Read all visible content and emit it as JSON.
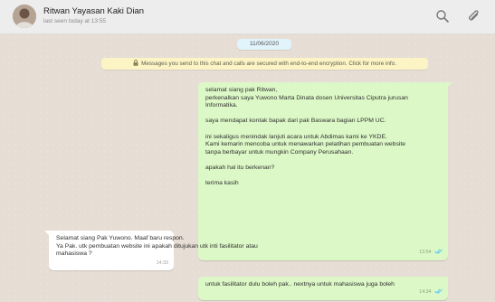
{
  "header": {
    "contact_name": "Ritwan Yayasan Kaki Dian",
    "last_seen": "last seen today at 13:55",
    "icons": [
      "search-icon",
      "paperclip-icon"
    ]
  },
  "chat": {
    "date": "11/06/2020",
    "encryption_notice": "Messages you send to this chat and calls are secured with end-to-end encryption. Click for more info.",
    "messages": [
      {
        "direction": "outgoing",
        "lines": [
          "selamat siang pak Ritwan,",
          "perkenalkan saya Yuwono Marta Dinata dosen Universitas Ciputra jurusan",
          "Informatika.",
          "",
          "saya mendapat kontak bapak dari pak Baswara bagian LPPM UC.",
          "",
          "ini sekaligus menindak lanjuti acara untuk Abdimas kami ke YKDE.",
          "Kami kemarin mencoba untuk menawarkan pelatihan pembuatan website",
          "tanpa berbayar untuk mungkin Company Perusahaan.",
          "",
          "apakah hal itu berkenan?",
          "",
          "terima kasih"
        ],
        "time": "13:54"
      },
      {
        "direction": "incoming",
        "lines": [
          "Selamat siang Pak Yuwono. Maaf baru respon.",
          "Ya Pak. utk pembuatan website ini apakah ditujukan utk inti fasilitator atau",
          "mahasiswa ?"
        ],
        "time": "14:33"
      },
      {
        "direction": "outgoing",
        "lines": [
          "untuk fasilitator dulu boleh pak.. nextnya untuk mahasiswa juga boleh"
        ],
        "time": "14:34"
      }
    ]
  },
  "colors": {
    "chat_background": "#e6ddd4",
    "outgoing_bubble": "#dcf8c6",
    "incoming_bubble": "#ffffff",
    "notice_background": "#fcf4c4",
    "date_chip": "#e1f3fb",
    "read_tick": "#4fc3f7"
  }
}
